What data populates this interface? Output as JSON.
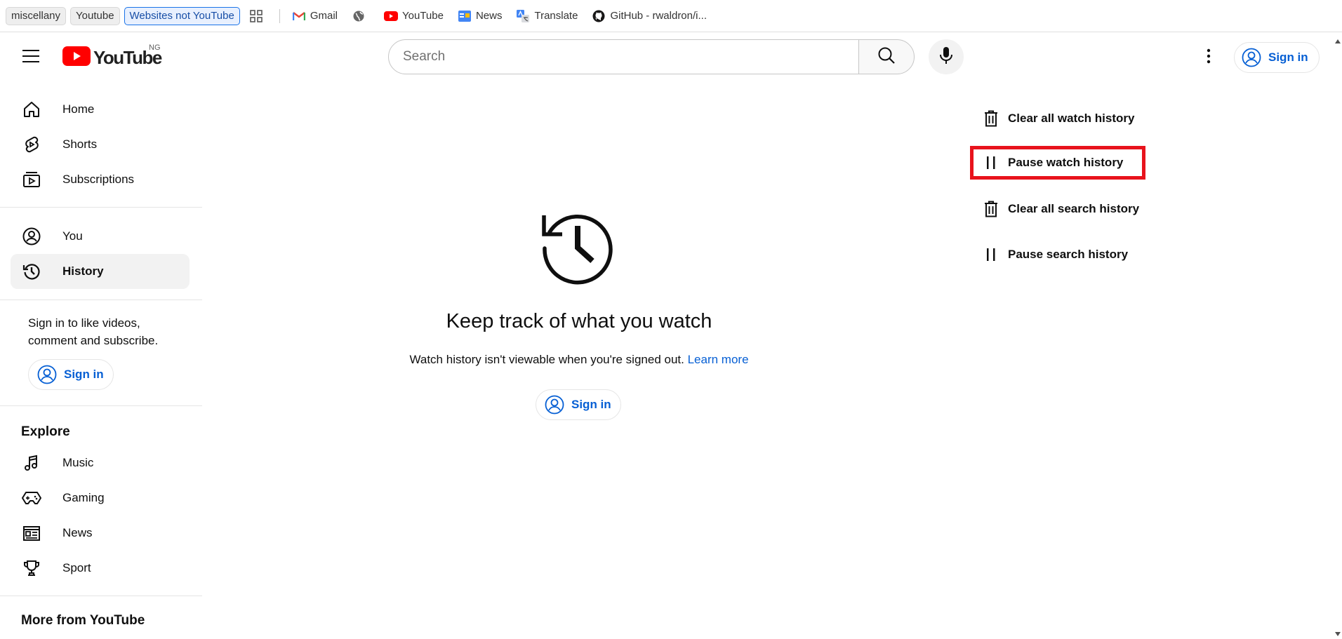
{
  "bookmarks": {
    "items": [
      {
        "label": "miscellany"
      },
      {
        "label": "Youtube"
      },
      {
        "label": "Websites not YouTube"
      },
      {
        "label": "Gmail"
      },
      {
        "label": "YouTube"
      },
      {
        "label": "News"
      },
      {
        "label": "Translate"
      },
      {
        "label": "GitHub - rwaldron/i..."
      }
    ]
  },
  "masthead": {
    "logo_text": "YouTube",
    "country_code": "NG",
    "search_placeholder": "Search",
    "signin_label": "Sign in"
  },
  "sidebar": {
    "primary": [
      {
        "label": "Home",
        "icon": "home-icon"
      },
      {
        "label": "Shorts",
        "icon": "shorts-icon"
      },
      {
        "label": "Subscriptions",
        "icon": "subscriptions-icon"
      }
    ],
    "you": [
      {
        "label": "You",
        "icon": "account-icon"
      },
      {
        "label": "History",
        "icon": "history-icon",
        "selected": true
      }
    ],
    "signin_prompt": "Sign in to like videos, comment and subscribe.",
    "signin_label": "Sign in",
    "explore_title": "Explore",
    "explore": [
      {
        "label": "Music",
        "icon": "music-icon"
      },
      {
        "label": "Gaming",
        "icon": "gaming-icon"
      },
      {
        "label": "News",
        "icon": "news-icon"
      },
      {
        "label": "Sport",
        "icon": "trophy-icon"
      }
    ],
    "more_title": "More from YouTube"
  },
  "main": {
    "title": "Keep track of what you watch",
    "description": "Watch history isn't viewable when you're signed out.",
    "learn_more": "Learn more",
    "signin_label": "Sign in"
  },
  "actions": [
    {
      "label": "Clear all watch history",
      "icon": "trash-icon"
    },
    {
      "label": "Pause watch history",
      "icon": "pause-icon",
      "highlighted": true
    },
    {
      "label": "Clear all search history",
      "icon": "trash-icon"
    },
    {
      "label": "Pause search history",
      "icon": "pause-icon"
    }
  ],
  "colors": {
    "brand_red": "#ff0000",
    "link_blue": "#065fd4",
    "highlight_red": "#e8131c"
  }
}
